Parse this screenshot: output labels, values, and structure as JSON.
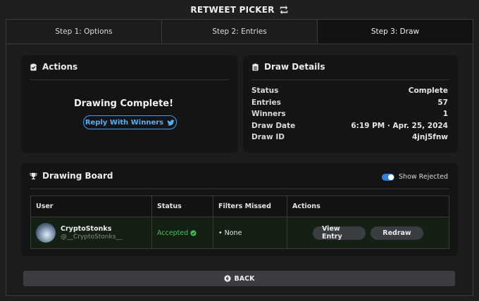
{
  "app": {
    "title": "RETWEET PICKER",
    "title_icon": "retweet-icon"
  },
  "tabs": [
    {
      "label": "Step 1: Options",
      "active": false
    },
    {
      "label": "Step 2: Entries",
      "active": false
    },
    {
      "label": "Step 3: Draw",
      "active": true
    }
  ],
  "actions": {
    "header": "Actions",
    "header_icon": "clipboard-check-icon",
    "status_text": "Drawing Complete!",
    "reply_button": "Reply With Winners",
    "reply_icon": "twitter-bird-icon"
  },
  "details": {
    "header": "Draw Details",
    "header_icon": "clipboard-list-icon",
    "rows": [
      {
        "key": "Status",
        "value": "Complete"
      },
      {
        "key": "Entries",
        "value": "57"
      },
      {
        "key": "Winners",
        "value": "1"
      },
      {
        "key": "Draw Date",
        "value": "6:19 PM · Apr. 25, 2024"
      },
      {
        "key": "Draw ID",
        "value": "4jnj5fnw"
      }
    ]
  },
  "board": {
    "header": "Drawing Board",
    "header_icon": "trophy-icon",
    "toggle_label": "Show Rejected",
    "toggle_on": true,
    "columns": [
      "User",
      "Status",
      "Filters Missed",
      "Actions"
    ],
    "rows": [
      {
        "name": "CryptoStonks",
        "handle": "@__CryptoStonks__",
        "status": "Accepted",
        "filters_missed": "• None",
        "view_label": "View Entry",
        "redraw_label": "Redraw"
      }
    ]
  },
  "back_button": "BACK",
  "colors": {
    "accent_blue": "#3aa0ef",
    "accepted_green": "#3ec35a",
    "toggle_blue": "#2f7fe0"
  }
}
